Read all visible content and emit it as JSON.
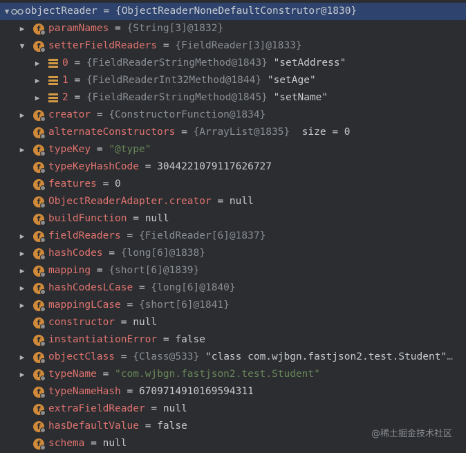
{
  "root": {
    "name": "objectReader",
    "value": "{ObjectReaderNoneDefaultConstrutor@1830}"
  },
  "rows": [
    {
      "name": "paramNames",
      "ref": "{String[3]@1832}"
    },
    {
      "name": "setterFieldReaders",
      "ref": "{FieldReader[3]@1833}"
    },
    {
      "index": "0",
      "ref": "{FieldReaderStringMethod@1843}",
      "label": "\"setAddress\""
    },
    {
      "index": "1",
      "ref": "{FieldReaderInt32Method@1844}",
      "label": "\"setAge\""
    },
    {
      "index": "2",
      "ref": "{FieldReaderStringMethod@1845}",
      "label": "\"setName\""
    },
    {
      "name": "creator",
      "ref": "{ConstructorFunction@1834}"
    },
    {
      "name": "alternateConstructors",
      "ref": "{ArrayList@1835}",
      "extra": "size = 0"
    },
    {
      "name": "typeKey",
      "str": "\"@type\""
    },
    {
      "name": "typeKeyHashCode",
      "value": "3044221079117626727"
    },
    {
      "name": "features",
      "value": "0"
    },
    {
      "name": "ObjectReaderAdapter.creator",
      "value": "null"
    },
    {
      "name": "buildFunction",
      "value": "null"
    },
    {
      "name": "fieldReaders",
      "ref": "{FieldReader[6]@1837}"
    },
    {
      "name": "hashCodes",
      "ref": "{long[6]@1838}"
    },
    {
      "name": "mapping",
      "ref": "{short[6]@1839}"
    },
    {
      "name": "hashCodesLCase",
      "ref": "{long[6]@1840}"
    },
    {
      "name": "mappingLCase",
      "ref": "{short[6]@1841}"
    },
    {
      "name": "constructor",
      "value": "null"
    },
    {
      "name": "instantiationError",
      "value": "false"
    },
    {
      "name": "objectClass",
      "ref": "{Class@533}",
      "label": "\"class com.wjbgn.fastjson2.test.Student\"",
      "more": "…"
    },
    {
      "name": "typeName",
      "str": "\"com.wjbgn.fastjson2.test.Student\""
    },
    {
      "name": "typeNameHash",
      "value": "6709714910169594311"
    },
    {
      "name": "extraFieldReader",
      "value": "null"
    },
    {
      "name": "hasDefaultValue",
      "value": "false"
    },
    {
      "name": "schema",
      "value": "null"
    }
  ],
  "eq": "=",
  "field_icon_letter": "f",
  "watermark": "@稀土掘金技术社区",
  "colors": {
    "background": "#2b2d30",
    "selection": "#2e436e",
    "field_name": "#e0736f",
    "reference": "#8a8f96",
    "string": "#6a8759",
    "field_icon": "#d08a3a"
  }
}
